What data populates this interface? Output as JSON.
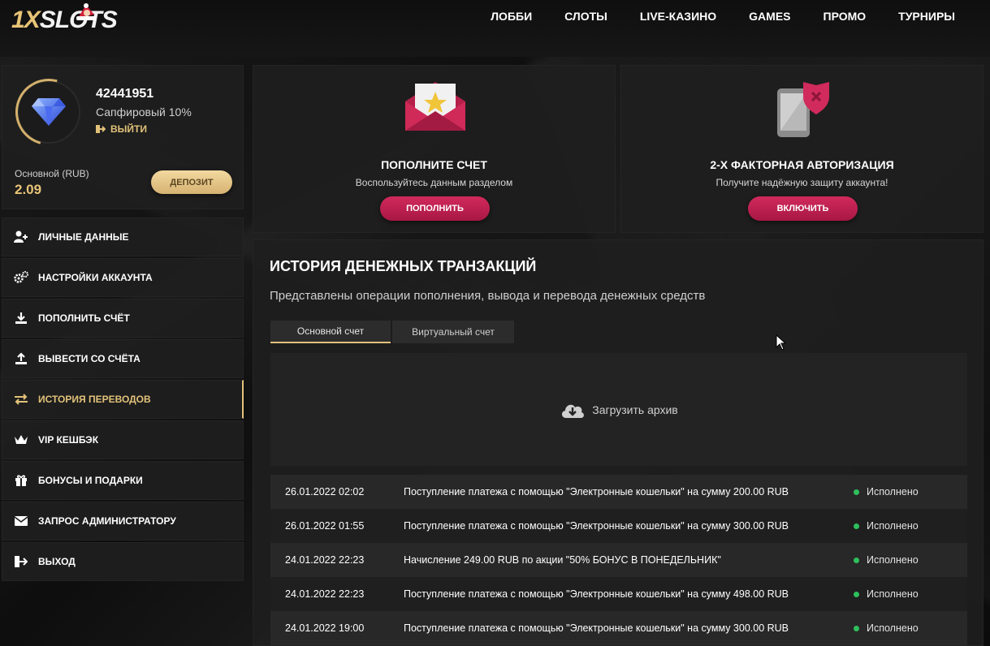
{
  "brand": {
    "logo_one": "1X",
    "logo_rest": "SLOTS"
  },
  "nav": [
    "ЛОББИ",
    "СЛОТЫ",
    "LIVE-КАЗИНО",
    "GAMES",
    "ПРОМО",
    "ТУРНИРЫ"
  ],
  "profile": {
    "user_id": "42441951",
    "status": "Сапфировый 10%",
    "logout_label": "ВЫЙТИ",
    "balance_label": "Основной (RUB)",
    "balance_value": "2.09",
    "deposit_label": "ДЕПОЗИТ"
  },
  "menu": [
    {
      "label": "ЛИЧНЫЕ ДАННЫЕ",
      "icon": "user-plus-icon"
    },
    {
      "label": "НАСТРОЙКИ АККАУНТА",
      "icon": "gears-icon"
    },
    {
      "label": "ПОПОЛНИТЬ СЧЁТ",
      "icon": "download-icon"
    },
    {
      "label": "ВЫВЕСТИ СО СЧЁТА",
      "icon": "upload-icon"
    },
    {
      "label": "ИСТОРИЯ ПЕРЕВОДОВ",
      "icon": "transfer-icon",
      "active": true
    },
    {
      "label": "VIP КЕШБЭК",
      "icon": "crown-icon"
    },
    {
      "label": "БОНУСЫ И ПОДАРКИ",
      "icon": "gift-icon"
    },
    {
      "label": "ЗАПРОС АДМИНИСТРАТОРУ",
      "icon": "envelope-icon"
    },
    {
      "label": "ВЫХОД",
      "icon": "logout-icon"
    }
  ],
  "cards": {
    "deposit": {
      "title": "ПОПОЛНИТЕ СЧЕТ",
      "subtitle": "Воспользуйтесь данным разделом",
      "button": "ПОПОЛНИТЬ"
    },
    "twofa": {
      "title": "2-Х ФАКТОРНАЯ АВТОРИЗАЦИЯ",
      "subtitle": "Получите надёжную защиту аккаунта!",
      "button": "ВКЛЮЧИТЬ"
    }
  },
  "history": {
    "title": "ИСТОРИЯ ДЕНЕЖНЫХ ТРАНЗАКЦИЙ",
    "description": "Представлены операции пополнения, вывода и перевода денежных средств",
    "tabs": [
      "Основной счет",
      "Виртуальный счет"
    ],
    "archive_label": "Загрузить архив",
    "rows": [
      {
        "date": "26.01.2022 02:02",
        "desc": "Поступление платежа с помощью \"Электронные кошельки\" на сумму 200.00 RUB",
        "status": "Исполнено"
      },
      {
        "date": "26.01.2022 01:55",
        "desc": "Поступление платежа с помощью \"Электронные кошельки\" на сумму 300.00 RUB",
        "status": "Исполнено"
      },
      {
        "date": "24.01.2022 22:23",
        "desc": "Начисление 249.00 RUB по акции \"50% БОНУС В ПОНЕДЕЛЬНИК\"",
        "status": "Исполнено"
      },
      {
        "date": "24.01.2022 22:23",
        "desc": "Поступление платежа с помощью \"Электронные кошельки\" на сумму 498.00 RUB",
        "status": "Исполнено"
      },
      {
        "date": "24.01.2022 19:00",
        "desc": "Поступление платежа с помощью \"Электронные кошельки\" на сумму 300.00 RUB",
        "status": "Исполнено"
      }
    ]
  },
  "colors": {
    "gold": "#e2c27a",
    "accent": "#d12a5c",
    "success": "#2ec05c"
  }
}
